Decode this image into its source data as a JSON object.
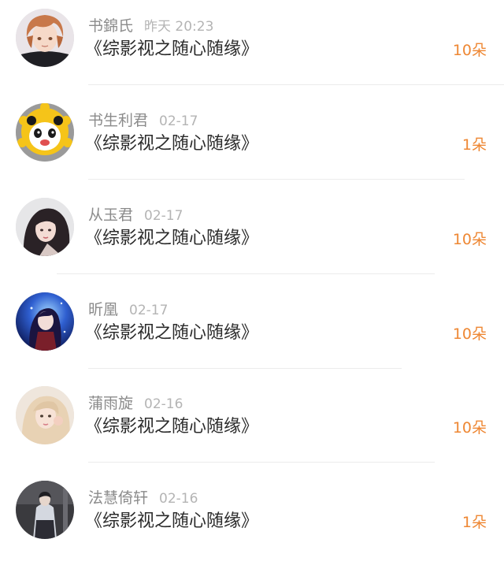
{
  "gifts": [
    {
      "name": "书錦氏",
      "time": "昨天 20:23",
      "book": "《综影视之随心随缘》",
      "amount": "10朵",
      "avatar_icon": "anime-boy-avatar-icon"
    },
    {
      "name": "书生利君",
      "time": "02-17",
      "book": "《综影视之随心随缘》",
      "amount": "1朵",
      "avatar_icon": "panda-sun-avatar-icon"
    },
    {
      "name": "从玉君",
      "time": "02-17",
      "book": "《综影视之随心随缘》",
      "amount": "10朵",
      "avatar_icon": "woman-portrait-avatar-icon"
    },
    {
      "name": "昕凰",
      "time": "02-17",
      "book": "《综影视之随心随缘》",
      "amount": "10朵",
      "avatar_icon": "anime-girl-avatar-icon"
    },
    {
      "name": "蒲雨旋",
      "time": "02-16",
      "book": "《综影视之随心随缘》",
      "amount": "10朵",
      "avatar_icon": "girl-selfie-avatar-icon"
    },
    {
      "name": "法慧倚轩",
      "time": "02-16",
      "book": "《综影视之随心随缘》",
      "amount": "1朵",
      "avatar_icon": "person-photo-avatar-icon"
    }
  ]
}
